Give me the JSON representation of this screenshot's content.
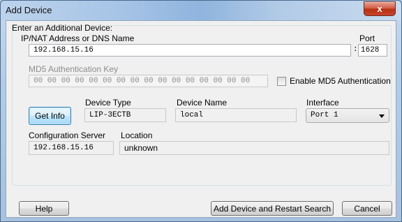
{
  "window": {
    "title": "Add Device",
    "close_label": "x"
  },
  "group": {
    "label": "Enter an Additional Device:"
  },
  "address": {
    "label": "IP/NAT Address or DNS Name",
    "value": "192.168.15.16"
  },
  "port": {
    "label": "Port",
    "separator": ":",
    "value": "1628"
  },
  "md5": {
    "label": "MD5 Authentication Key",
    "value": "00 00 00 00 00 00 00 00 00 00 00 00 00 00 00 00",
    "enable_label": "Enable MD5 Authentication",
    "enabled": false
  },
  "device": {
    "get_info_label": "Get Info",
    "type_label": "Device Type",
    "type_value": "LIP-3ECTB",
    "name_label": "Device Name",
    "name_value": "local",
    "interface_label": "Interface",
    "interface_value": "Port 1"
  },
  "config": {
    "server_label": "Configuration Server",
    "server_value": "192.168.15.16",
    "location_label": "Location",
    "location_value": "unknown"
  },
  "buttons": {
    "help": "Help",
    "add_restart": "Add Device and Restart Search",
    "cancel": "Cancel"
  }
}
